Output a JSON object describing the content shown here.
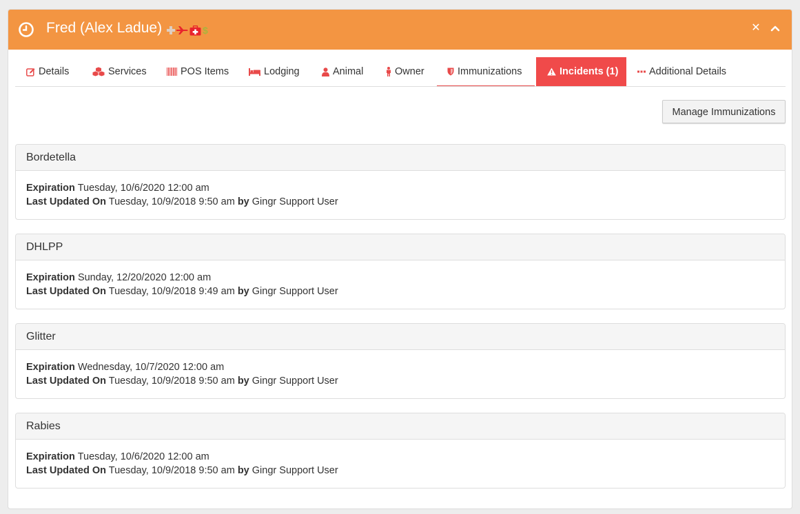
{
  "header": {
    "title": "Fred (Alex Ladue)",
    "accent_color": "#f39542",
    "status_icons": [
      "medical-plus-icon",
      "plane-icon",
      "first-aid-kit-icon",
      "dollar-icon"
    ]
  },
  "tabs": [
    {
      "label": "Details",
      "icon": "edit-icon"
    },
    {
      "label": "Services",
      "icon": "cubes-icon"
    },
    {
      "label": "POS Items",
      "icon": "barcode-icon"
    },
    {
      "label": "Lodging",
      "icon": "bed-icon"
    },
    {
      "label": "Animal",
      "icon": "user-icon"
    },
    {
      "label": "Owner",
      "icon": "male-icon"
    },
    {
      "label": "Immunizations",
      "icon": "shield-icon",
      "active": true
    },
    {
      "label": "Incidents (1)",
      "icon": "warning-icon",
      "highlight_color": "#f04a4a"
    },
    {
      "label": "Additional Details",
      "icon": "ellipsis-icon"
    }
  ],
  "manage_button": "Manage Immunizations",
  "labels": {
    "expiration": "Expiration",
    "last_updated": "Last Updated On",
    "by": "by"
  },
  "immunizations": [
    {
      "name": "Bordetella",
      "expiration": "Tuesday, 10/6/2020 12:00 am",
      "updated": "Tuesday, 10/9/2018 9:50 am",
      "user": "Gingr Support User"
    },
    {
      "name": "DHLPP",
      "expiration": "Sunday, 12/20/2020 12:00 am",
      "updated": "Tuesday, 10/9/2018 9:49 am",
      "user": "Gingr Support User"
    },
    {
      "name": "Glitter",
      "expiration": "Wednesday, 10/7/2020 12:00 am",
      "updated": "Tuesday, 10/9/2018 9:50 am",
      "user": "Gingr Support User"
    },
    {
      "name": "Rabies",
      "expiration": "Tuesday, 10/6/2020 12:00 am",
      "updated": "Tuesday, 10/9/2018 9:50 am",
      "user": "Gingr Support User"
    }
  ]
}
